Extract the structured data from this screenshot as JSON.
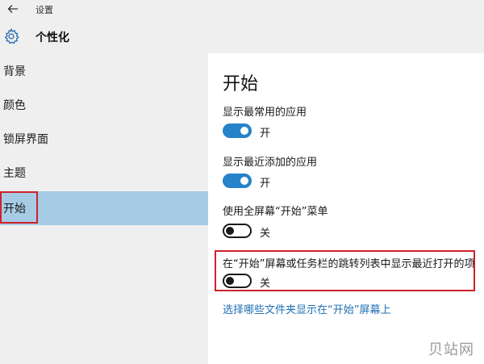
{
  "titlebar": {
    "back_icon": "arrow-left-icon",
    "title": "设置"
  },
  "header": {
    "icon": "gear-icon",
    "title": "个性化"
  },
  "sidebar": {
    "items": [
      {
        "label": "背景",
        "selected": false
      },
      {
        "label": "颜色",
        "selected": false
      },
      {
        "label": "锁屏界面",
        "selected": false
      },
      {
        "label": "主题",
        "selected": false
      },
      {
        "label": "开始",
        "selected": true
      }
    ]
  },
  "main": {
    "title": "开始",
    "settings": [
      {
        "label": "显示最常用的应用",
        "state": "开",
        "on": true
      },
      {
        "label": "显示最近添加的应用",
        "state": "开",
        "on": true
      },
      {
        "label": "使用全屏幕“开始”菜单",
        "state": "关",
        "on": false
      },
      {
        "label": "在“开始”屏幕或任务栏的跳转列表中显示最近打开的项",
        "state": "关",
        "on": false
      }
    ],
    "link": "选择哪些文件夹显示在“开始”屏幕上"
  },
  "watermark": "贝站网",
  "colors": {
    "accent": "#2583c9",
    "selected_bg": "#a6cbe5",
    "highlight": "#d0202a",
    "link": "#1f6fb5"
  }
}
